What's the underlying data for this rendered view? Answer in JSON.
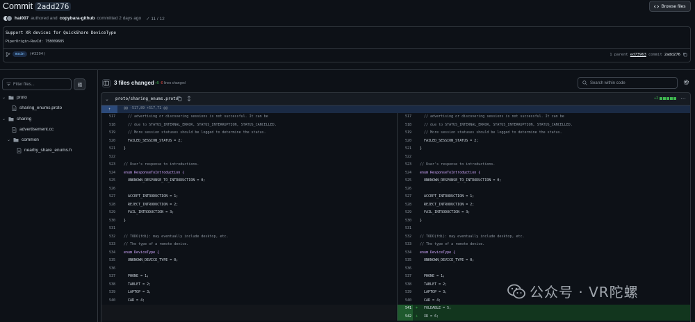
{
  "header": {
    "title_prefix": "Commit",
    "commit_hash": "2add276",
    "author1": "hai007",
    "authored_text": "authored and",
    "author2": "copybara-github",
    "committed_text": "committed 2 days ago",
    "checks": "11 / 12",
    "browse_label": "Browse files"
  },
  "commit": {
    "message": "Support XR devices for QuickShare DeviceType",
    "body": "PiperOrigin-RevId: 758009685",
    "branch": "main",
    "pr": "(#3394)",
    "parent_label": "1 parent",
    "parent_sha": "ed73963",
    "commit_label": "commit",
    "commit_sha": "2add276"
  },
  "sidebar": {
    "filter_placeholder": "Filter files...",
    "tree": [
      {
        "label": "proto",
        "kind": "folder"
      },
      {
        "label": "sharing_enums.proto",
        "kind": "file"
      },
      {
        "label": "sharing",
        "kind": "folder"
      },
      {
        "label": "advertisement.cc",
        "kind": "file"
      },
      {
        "label": "common",
        "kind": "folder"
      },
      {
        "label": "nearby_share_enums.h",
        "kind": "file"
      }
    ]
  },
  "toolbar": {
    "files_changed": "3 files changed",
    "additions": "+5",
    "deletions": "-0",
    "lines_changed": "lines changed",
    "search_placeholder": "Search within code"
  },
  "file": {
    "path": "proto/sharing_enums.proto",
    "stat": "+2"
  },
  "diff": {
    "hunk": "@@ -517,89 +517,71 @@",
    "lines": [
      {
        "n": "517",
        "text": "  // advertising or discovering sessions is not successful. It can be",
        "type": "cmt"
      },
      {
        "n": "518",
        "text": "  // due to STATUS_INTERNAL_ERROR, STATUS_INTERRUPTION, STATUS_CANCELLED.",
        "type": "cmt"
      },
      {
        "n": "519",
        "text": "  // More session statuses should be logged to determine the status.",
        "type": "cmt"
      },
      {
        "n": "520",
        "text": "  FAILED_SESSION_STATUS = 2;",
        "type": "code"
      },
      {
        "n": "521",
        "text": "}",
        "type": "code"
      },
      {
        "n": "522",
        "text": "",
        "type": "code"
      },
      {
        "n": "523",
        "text": "// User's response to introductions.",
        "type": "cmt"
      },
      {
        "n": "524",
        "text": "enum ResponseToIntroduction {",
        "type": "kw"
      },
      {
        "n": "525",
        "text": "  UNKNOWN_RESPONSE_TO_INTRODUCTION = 0;",
        "type": "code"
      },
      {
        "n": "526",
        "text": "",
        "type": "code"
      },
      {
        "n": "527",
        "text": "  ACCEPT_INTRODUCTION = 1;",
        "type": "code"
      },
      {
        "n": "528",
        "text": "  REJECT_INTRODUCTION = 2;",
        "type": "code"
      },
      {
        "n": "529",
        "text": "  FAIL_INTRODUCTION = 3;",
        "type": "code"
      },
      {
        "n": "530",
        "text": "}",
        "type": "code"
      },
      {
        "n": "531",
        "text": "",
        "type": "code"
      },
      {
        "n": "532",
        "text": "// TODO(fdi): may eventually include desktop, etc.",
        "type": "cmt"
      },
      {
        "n": "533",
        "text": "// The type of a remote device.",
        "type": "cmt"
      },
      {
        "n": "534",
        "text": "enum DeviceType {",
        "type": "kw"
      },
      {
        "n": "535",
        "text": "  UNKNOWN_DEVICE_TYPE = 0;",
        "type": "code"
      },
      {
        "n": "536",
        "text": "",
        "type": "code"
      },
      {
        "n": "537",
        "text": "  PHONE = 1;",
        "type": "code"
      },
      {
        "n": "538",
        "text": "  TABLET = 2;",
        "type": "code"
      },
      {
        "n": "539",
        "text": "  LAPTOP = 3;",
        "type": "code"
      },
      {
        "n": "540",
        "text": "  CAR = 4;",
        "type": "code"
      }
    ],
    "added": [
      {
        "n": "541",
        "marker": "+",
        "text": "  FOLDABLE = 5;"
      },
      {
        "n": "542",
        "marker": "+",
        "text": "  XR = 6;"
      }
    ]
  },
  "watermark": {
    "text": "公众号 · VR陀螺"
  },
  "colors": {
    "background": "#0d1117",
    "accent_link": "#79c0ff",
    "added_green": "#3fb950",
    "deleted_red": "#f85149"
  }
}
